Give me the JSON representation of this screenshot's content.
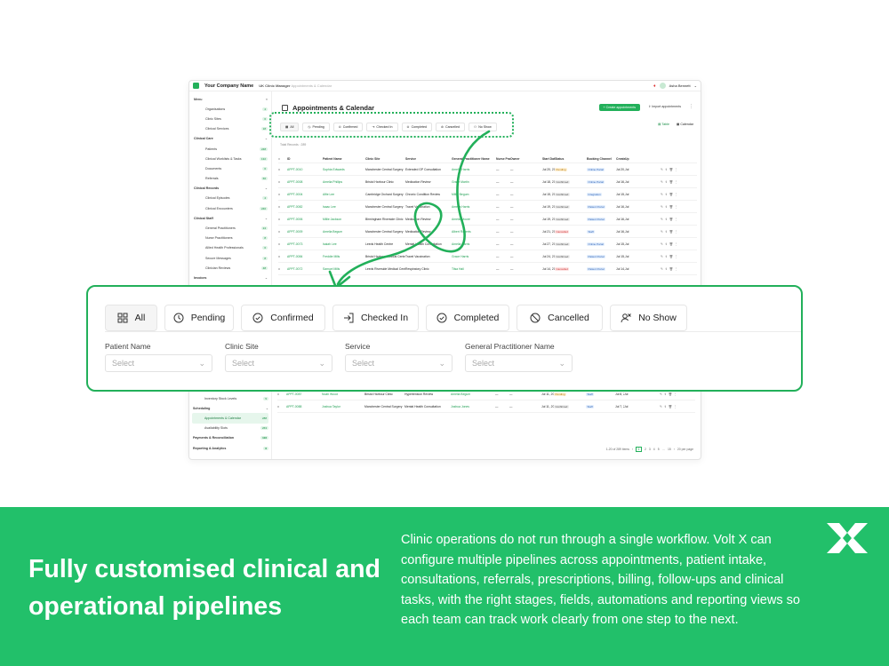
{
  "app": {
    "brand": "Your Company Name",
    "module": "UK Clinic Manager",
    "breadcrumb": "Appointments & Calendar",
    "user": "Asha Bennett"
  },
  "sidebar": {
    "menu_label": "Menu",
    "items": [
      {
        "label": "Organisations",
        "count": "4",
        "type": "item"
      },
      {
        "label": "Clinic Sites",
        "count": "6",
        "type": "item"
      },
      {
        "label": "Clinical Services",
        "count": "18",
        "type": "item"
      },
      {
        "label": "Clinical Care",
        "type": "section"
      },
      {
        "label": "Patients",
        "count": "248",
        "type": "item"
      },
      {
        "label": "Clinical Worklists & Tasks",
        "count": "132",
        "type": "item"
      },
      {
        "label": "Documents",
        "count": "6",
        "type": "item"
      },
      {
        "label": "Referrals",
        "count": "66",
        "type": "item"
      },
      {
        "label": "Clinical Records",
        "type": "section"
      },
      {
        "label": "Clinical Episodes",
        "count": "4",
        "type": "item"
      },
      {
        "label": "Clinical Encounters",
        "count": "240",
        "type": "item"
      },
      {
        "label": "Clinical Staff",
        "type": "section"
      },
      {
        "label": "General Practitioners",
        "count": "24",
        "type": "item"
      },
      {
        "label": "Nurse Practitioners",
        "count": "8",
        "type": "item"
      },
      {
        "label": "Allied Health Professionals",
        "count": "6",
        "type": "item"
      },
      {
        "label": "Secure Messages",
        "count": "8",
        "type": "item"
      },
      {
        "label": "Clinician Reviews",
        "count": "48",
        "type": "item"
      },
      {
        "label": "Invoices",
        "type": "section"
      }
    ],
    "lower_items": [
      {
        "label": "Inventory Stock Levels",
        "count": "5",
        "type": "item"
      },
      {
        "label": "Scheduling",
        "type": "section"
      },
      {
        "label": "Appointments & Calendar",
        "count": "288",
        "type": "active"
      },
      {
        "label": "Availability Slots",
        "count": "263",
        "type": "item"
      },
      {
        "label": "Payments & Reconciliation",
        "count": "116",
        "type": "section"
      },
      {
        "label": "Reporting & Analytics",
        "count": "6",
        "type": "section"
      }
    ]
  },
  "page": {
    "title": "Appointments & Calendar",
    "create_label": "+ Create appointments",
    "import_label": "Import appointments",
    "view_table": "Table",
    "view_calendar": "Calendar",
    "total_records": "Total Records : 289"
  },
  "tabs": [
    {
      "label": "All",
      "icon": "grid-icon"
    },
    {
      "label": "Pending",
      "icon": "clock-icon"
    },
    {
      "label": "Confirmed",
      "icon": "check-circle-icon"
    },
    {
      "label": "Checked In",
      "icon": "sign-in-icon"
    },
    {
      "label": "Completed",
      "icon": "check-circle-icon"
    },
    {
      "label": "Cancelled",
      "icon": "ban-icon"
    },
    {
      "label": "No Show",
      "icon": "user-x-icon"
    }
  ],
  "filters": [
    {
      "label": "Patient Name",
      "placeholder": "Select"
    },
    {
      "label": "Clinic Site",
      "placeholder": "Select"
    },
    {
      "label": "Service",
      "placeholder": "Select"
    },
    {
      "label": "General Practitioner Name",
      "placeholder": "Select"
    }
  ],
  "table": {
    "columns": [
      "ID",
      "Patient Name",
      "Clinic Site",
      "Service",
      "General Practitioner Name",
      "Nurse Practitioner Name",
      "Owner",
      "Start Date/time",
      "Status",
      "Booking Channel",
      "Created",
      "Up"
    ],
    "rows": [
      [
        "APPT-0010",
        "Sophia Edwards",
        "Manchester Central Surgery",
        "Extended GP Consultation",
        "Amelia Harris",
        "—",
        "—",
        "Jul 20, 2026 9:15 AM",
        "Pending",
        "Online Portal",
        "Jul 20, 2026 5:15 AM",
        "Jul"
      ],
      [
        "APPT-0008",
        "Amelia Phillips",
        "Bristol Harbour Clinic",
        "Medication Review",
        "Grace Martin",
        "—",
        "—",
        "Jul 18, 2026 9:15 AM",
        "Confirmed",
        "Online Portal",
        "Jul 16, 2026 5:30 AM",
        "Jul"
      ],
      [
        "APPT-0004",
        "Alfie Lee",
        "Cambridge Orchard Surgery",
        "Chronic Condition Review",
        "Millie Begum",
        "—",
        "—",
        "Jul 15, 2026 3:30 AM",
        "Confirmed",
        "Integration",
        "Jul 15, 2026 2:30 AM",
        "Jul"
      ],
      [
        "APPT-0082",
        "Isaac Lee",
        "Manchester Central Surgery",
        "Travel Vaccination",
        "Amelia Harris",
        "—",
        "—",
        "Jul 19, 2026 9:30 AM",
        "Confirmed",
        "Patient Portal",
        "Jul 16, 2026 6:30 AM",
        "Jul"
      ],
      [
        "APPT-0006",
        "Millie Jackson",
        "Birmingham Riverside Clinic",
        "Medication Review",
        "Amelia Moore",
        "—",
        "—",
        "Jul 19, 2026 9:15 AM",
        "Confirmed",
        "Patient Portal",
        "Jul 16, 2026 5:15 AM",
        "Jul"
      ],
      [
        "APPT-0009",
        "Amelia Begum",
        "Manchester Central Surgery",
        "Medication Review",
        "Albert Roberts",
        "—",
        "—",
        "Jul 21, 2026 3:15 AM",
        "Cancelled",
        "Staff",
        "Jul 16, 2026 2:45 AM",
        "Jul"
      ],
      [
        "APPT-0073",
        "Isaiah Lee",
        "Leeds Health Centre",
        "Mental Health Consultation",
        "Amelia Harris",
        "—",
        "—",
        "Jul 27, 2026 9:15 AM",
        "Confirmed",
        "Online Portal",
        "Jul 15, 2026 3:15 AM",
        "Jul"
      ],
      [
        "APPT-0084",
        "Freddie Mills",
        "Bristol Harbour Medical Centre",
        "Travel Vaccination",
        "Grace Harris",
        "—",
        "—",
        "Jul 24, 2026 9:45 AM",
        "Confirmed",
        "Patient Portal",
        "Jul 15, 2026 1:00 AM",
        "Jul"
      ],
      [
        "APPT-0072",
        "Samuel Mills",
        "Leeds Riverside Medical Centre",
        "Respiratory Clinic",
        "Tilsa Hall",
        "—",
        "—",
        "Jul 14, 2026 2:30 AM",
        "Cancelled",
        "Patient Portal",
        "Jul 14, 2026 11:15 PM",
        "Jul"
      ]
    ],
    "lower_rows": [
      [
        "APPT-0087",
        "Noah Wood",
        "Bristol Harbour Clinic",
        "Hypertension Review",
        "Amelia Begum",
        "—",
        "—",
        "Jul 11, 2026 8:30 AM",
        "Pending",
        "Staff",
        "Jul 8, 2026 5:35 AM",
        "Jul"
      ],
      [
        "APPT-0088",
        "Joshua Taylor",
        "Manchester Central Surgery",
        "Mental Health Consultation",
        "Joshua Jones",
        "—",
        "—",
        "Jul 11, 2026 6:45 AM",
        "Confirmed",
        "Staff",
        "Jul 7, 2026 10:05 PM",
        "Jul"
      ]
    ],
    "pager": {
      "range": "1-20 of 289 items",
      "pages": [
        "1",
        "2",
        "3",
        "4",
        "5",
        "…",
        "15"
      ],
      "per_page": "20 per page"
    }
  },
  "footer": {
    "headline": "Fully customised clinical and operational pipelines",
    "body": "Clinic operations do not run through a single workflow. Volt X can configure multiple pipelines across appointments, patient intake, consultations, referrals, prescriptions, billing, follow-ups and clinical tasks, with the right stages, fields, automations and reporting views so each team can track work clearly from one step to the next."
  },
  "colors": {
    "accent": "#22b05a",
    "band": "#22c06a"
  }
}
